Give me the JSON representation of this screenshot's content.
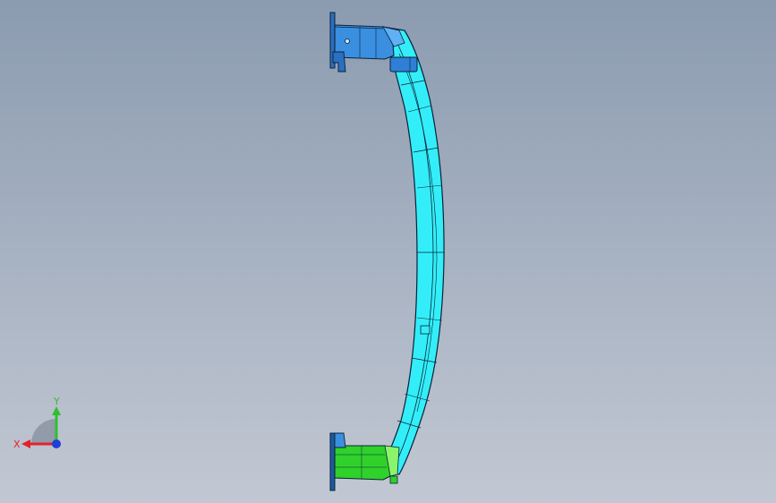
{
  "viewport": {
    "background_top": "#8b9bb0",
    "background_bottom": "#c2c8d3"
  },
  "model": {
    "parts": [
      {
        "name": "top-mounting-bracket",
        "color": "#3a8fe0"
      },
      {
        "name": "curved-beam",
        "color": "#33eef8"
      },
      {
        "name": "bottom-mounting-bracket",
        "color": "#2fd12a"
      }
    ],
    "edge_color": "#0a2238"
  },
  "triad": {
    "x_label": "X",
    "y_label": "Y",
    "x_color": "#e0232a",
    "y_color": "#2fbf2f",
    "z_color": "#1f3fd6"
  }
}
